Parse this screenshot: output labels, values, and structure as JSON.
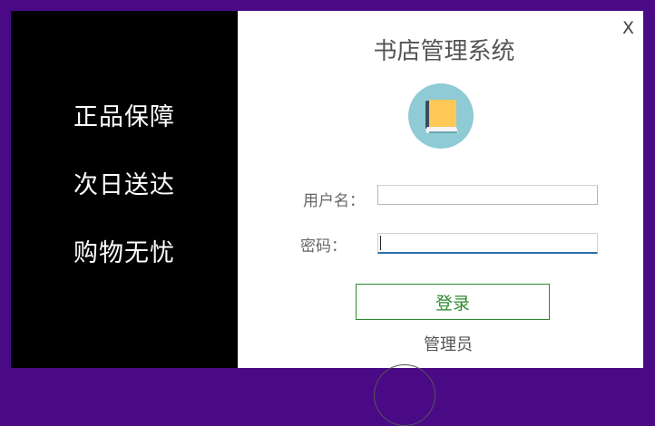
{
  "slogans": {
    "line1": "正品保障",
    "line2": "次日送达",
    "line3": "购物无忧"
  },
  "window": {
    "title": "书店管理系统",
    "close_label": "X"
  },
  "logo": {
    "icon": "book-icon",
    "circle_color": "#8ecbd4"
  },
  "form": {
    "username_label": "用户名：",
    "username_value": "",
    "password_label": "密码：",
    "password_value": ""
  },
  "actions": {
    "login_label": "登录",
    "role_label": "管理员"
  },
  "colors": {
    "frame": "#4a0a86",
    "left_panel": "#000000",
    "login_accent": "#2f8a2f",
    "focus_underline": "#2e6da8"
  }
}
